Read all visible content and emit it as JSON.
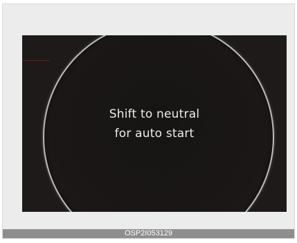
{
  "display": {
    "message_line1": "Shift to neutral",
    "message_line2": "for auto start"
  },
  "caption": {
    "code": "OSP2I053129"
  },
  "colors": {
    "screen_background": "#1e1a1a",
    "ring": "#bdbdbd",
    "text": "#ececec",
    "caption_bar": "#8e8e8e"
  }
}
